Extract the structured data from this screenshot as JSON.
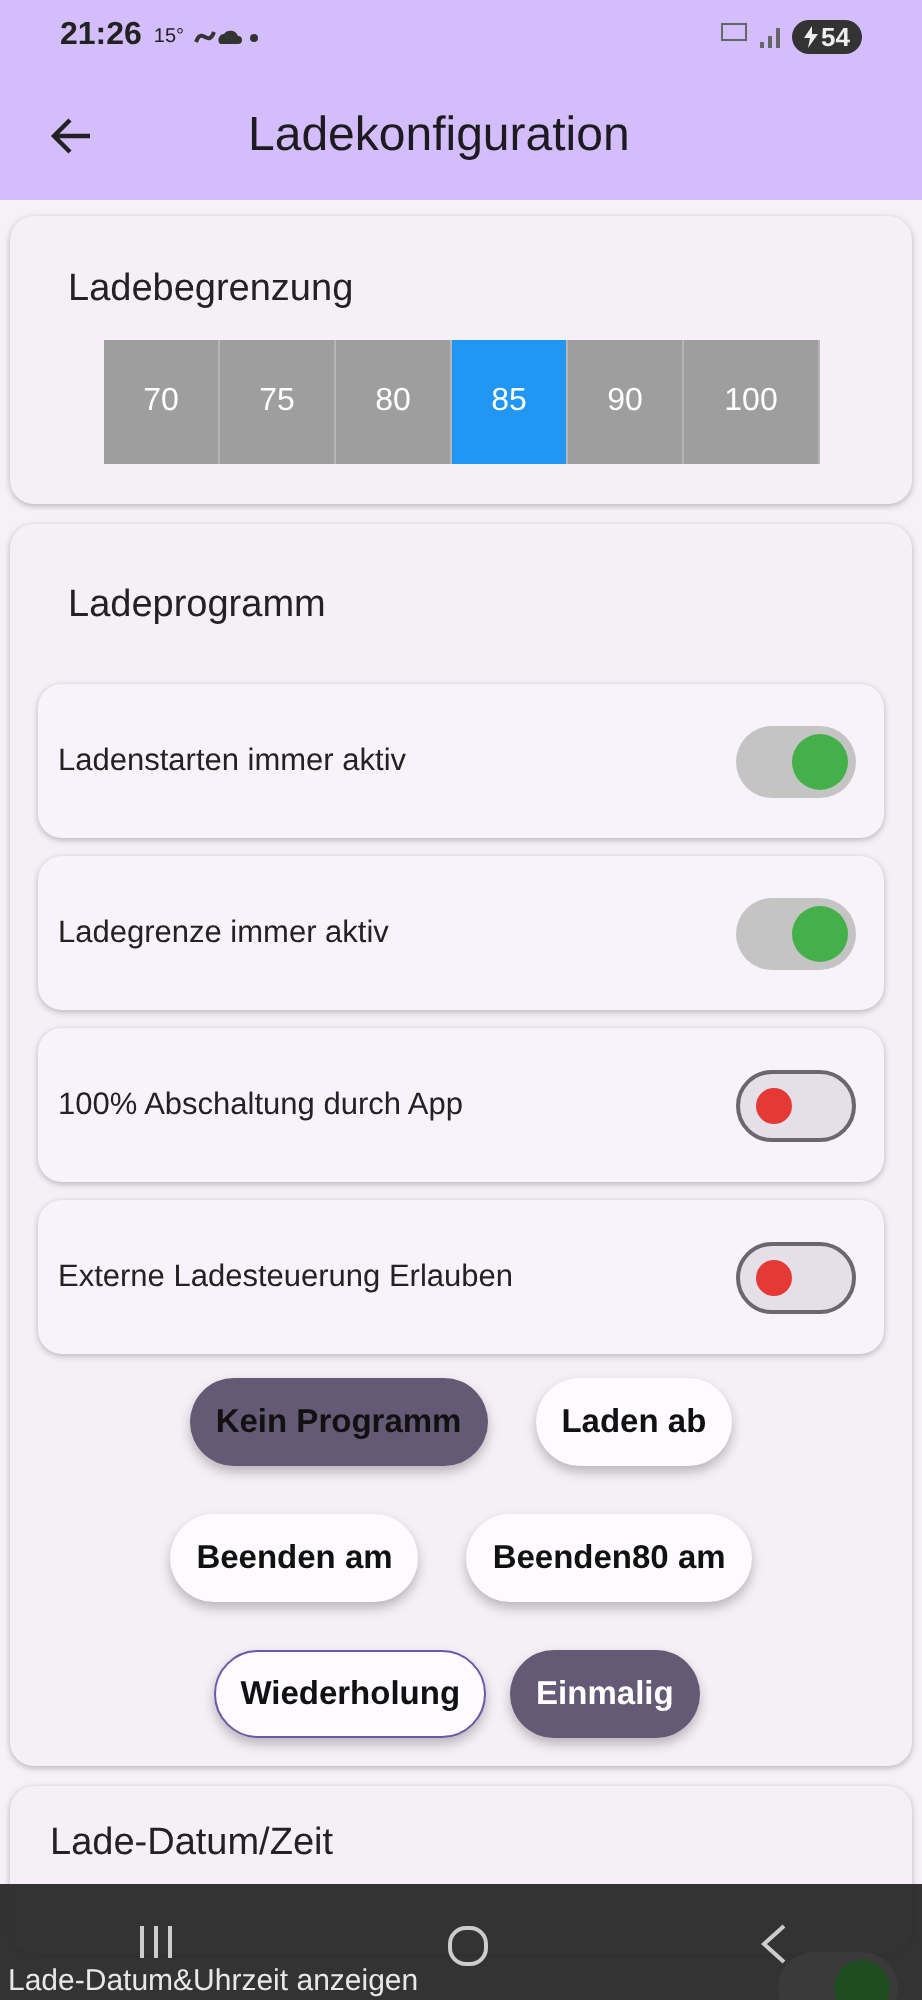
{
  "status_bar": {
    "time": "21:26",
    "temperature": "15°",
    "battery": "54"
  },
  "app_bar": {
    "title": "Ladekonfiguration"
  },
  "limit_card": {
    "title": "Ladebegrenzung",
    "options": [
      {
        "label": "70",
        "selected": false
      },
      {
        "label": "75",
        "selected": false
      },
      {
        "label": "80",
        "selected": false
      },
      {
        "label": "85",
        "selected": true
      },
      {
        "label": "90",
        "selected": false
      },
      {
        "label": "100",
        "selected": false
      }
    ]
  },
  "program_card": {
    "title": "Ladeprogramm",
    "switches": [
      {
        "label": "Ladenstarten immer aktiv",
        "on": true
      },
      {
        "label": "Ladegrenze immer aktiv",
        "on": true
      },
      {
        "label": "100% Abschaltung durch App",
        "on": false
      },
      {
        "label": "Externe Ladesteuerung Erlauben",
        "on": false
      }
    ],
    "program_chips": [
      {
        "label": "Kein Programm",
        "selected": true
      },
      {
        "label": "Laden ab",
        "selected": false
      },
      {
        "label": "Beenden am",
        "selected": false
      },
      {
        "label": "Beenden80 am",
        "selected": false
      }
    ],
    "mode_chips": [
      {
        "label": "Wiederholung",
        "selected": false
      },
      {
        "label": "Einmalig",
        "selected": true
      }
    ]
  },
  "datetime_card": {
    "title": "Lade-Datum/Zeit",
    "switches": [
      {
        "label": "Lade-Datum&Uhrzeit anzeigen",
        "on": true
      }
    ]
  }
}
